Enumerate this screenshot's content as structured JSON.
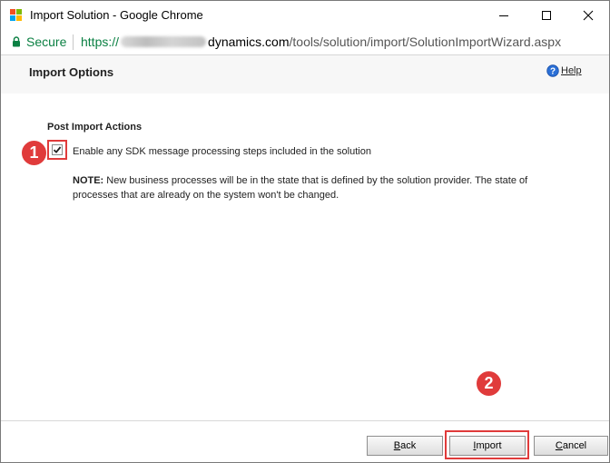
{
  "window": {
    "title": "Import Solution - Google Chrome"
  },
  "addressbar": {
    "secure_label": "Secure",
    "url_scheme": "https://",
    "url_domain": "dynamics.com",
    "url_path": "/tools/solution/import/SolutionImportWizard.aspx"
  },
  "page": {
    "title": "Import Options",
    "help_label": "Help"
  },
  "post_import": {
    "section_title": "Post Import Actions",
    "checkbox_label": "Enable any SDK message processing steps included in the solution",
    "checked": true,
    "note_label": "NOTE:",
    "note_text": " New business processes will be in the state that is defined by the solution provider. The state of processes that are already on the system won't be changed."
  },
  "annotations": {
    "badge_1": "1",
    "badge_2": "2",
    "highlight_color": "#e03b3b"
  },
  "footer": {
    "back_label": "Back",
    "back_mnemonic": "B",
    "back_rest": "ack",
    "import_label": "Import",
    "import_mnemonic": "I",
    "import_rest": "mport",
    "cancel_label": "Cancel",
    "cancel_mnemonic": "C",
    "cancel_rest": "ancel"
  },
  "icons": {
    "app_logo": "microsoft-logo-icon",
    "lock": "lock-icon",
    "help": "help-icon",
    "minimize": "minimize-icon",
    "maximize": "maximize-icon",
    "close": "close-icon",
    "check": "checkmark-icon"
  },
  "colors": {
    "secure_green": "#0b8043",
    "badge_red": "#e03b3b",
    "header_bg": "#f7f7f7"
  }
}
